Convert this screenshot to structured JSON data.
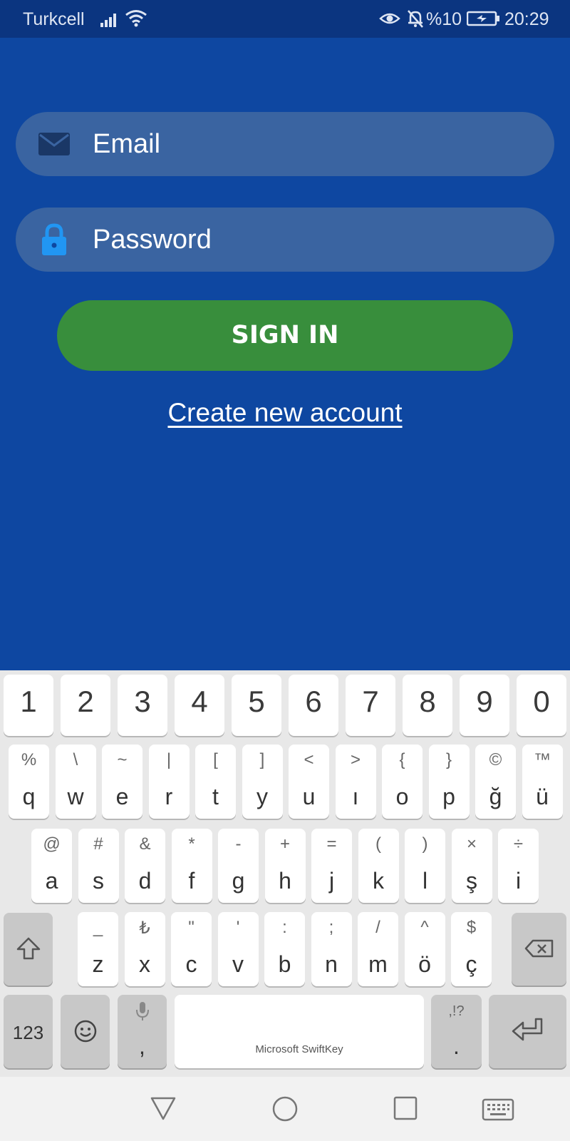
{
  "status_bar": {
    "carrier": "Turkcell",
    "battery": "%10",
    "time": "20:29",
    "icons": [
      "signal-icon",
      "wifi-icon",
      "eye-icon",
      "bell-muted-icon",
      "battery-charging-icon"
    ]
  },
  "login": {
    "email_placeholder": "Email",
    "password_placeholder": "Password",
    "sign_in": "SIGN IN",
    "create_account": "Create new account"
  },
  "colors": {
    "background": "#0e47a1",
    "status_bar": "#0b3580",
    "field": "#3a64a1",
    "sign_in": "#388e3c",
    "lock_icon": "#2196f3",
    "mail_icon": "#1a3766"
  },
  "keyboard": {
    "number_row": [
      "1",
      "2",
      "3",
      "4",
      "5",
      "6",
      "7",
      "8",
      "9",
      "0"
    ],
    "row1": [
      {
        "sec": "%",
        "key": "q"
      },
      {
        "sec": "\\",
        "key": "w"
      },
      {
        "sec": "~",
        "key": "e"
      },
      {
        "sec": "|",
        "key": "r"
      },
      {
        "sec": "[",
        "key": "t"
      },
      {
        "sec": "]",
        "key": "y"
      },
      {
        "sec": "<",
        "key": "u"
      },
      {
        "sec": ">",
        "key": "ı"
      },
      {
        "sec": "{",
        "key": "o"
      },
      {
        "sec": "}",
        "key": "p"
      },
      {
        "sec": "©",
        "key": "ğ"
      },
      {
        "sec": "™",
        "key": "ü"
      }
    ],
    "row2": [
      {
        "sec": "@",
        "key": "a"
      },
      {
        "sec": "#",
        "key": "s"
      },
      {
        "sec": "&",
        "key": "d"
      },
      {
        "sec": "*",
        "key": "f"
      },
      {
        "sec": "-",
        "key": "g"
      },
      {
        "sec": "+",
        "key": "h"
      },
      {
        "sec": "=",
        "key": "j"
      },
      {
        "sec": "(",
        "key": "k"
      },
      {
        "sec": ")",
        "key": "l"
      },
      {
        "sec": "×",
        "key": "ş"
      },
      {
        "sec": "÷",
        "key": "i"
      }
    ],
    "row3": [
      {
        "sec": "_",
        "key": "z"
      },
      {
        "sec": "₺",
        "key": "x"
      },
      {
        "sec": "\"",
        "key": "c"
      },
      {
        "sec": "'",
        "key": "v"
      },
      {
        "sec": ":",
        "key": "b"
      },
      {
        "sec": ";",
        "key": "n"
      },
      {
        "sec": "/",
        "key": "m"
      },
      {
        "sec": "^",
        "key": "ö"
      },
      {
        "sec": "$",
        "key": "ç"
      }
    ],
    "numbers_key": "123",
    "comma_key": ",",
    "period_sec": ",!?",
    "period_key": ".",
    "space_brand": "Microsoft SwiftKey"
  },
  "nav_bar": {
    "icons": [
      "back-icon",
      "home-icon",
      "recents-icon",
      "keyboard-switch-icon"
    ]
  }
}
